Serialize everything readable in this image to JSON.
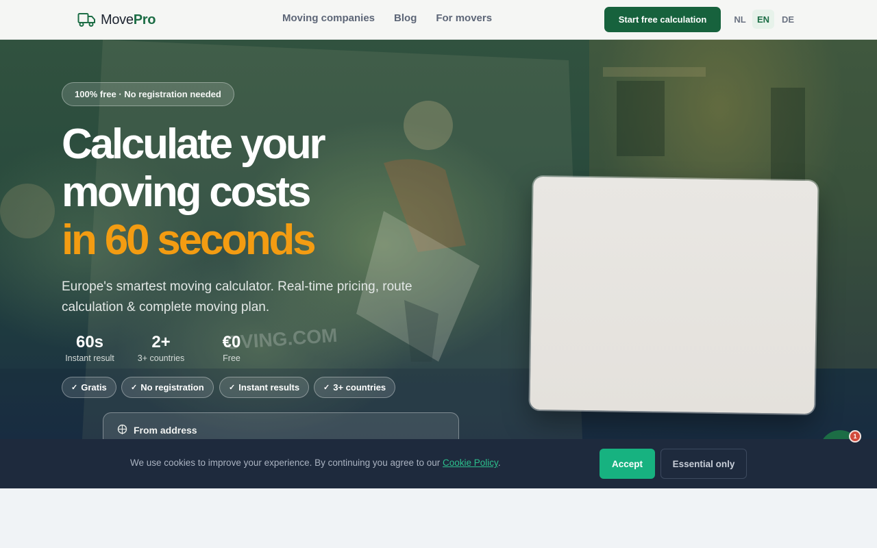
{
  "header": {
    "logo": {
      "prefix": "Move",
      "suffix": "Pro",
      "icon": "truck-icon"
    },
    "nav": [
      "Moving companies",
      "Blog",
      "For movers"
    ],
    "cta": "Start free calculation",
    "languages": [
      {
        "code": "NL",
        "active": false
      },
      {
        "code": "EN",
        "active": true
      },
      {
        "code": "DE",
        "active": false
      }
    ]
  },
  "hero": {
    "badge": "100% free · No registration needed",
    "title_line1": "Calculate your",
    "title_line2": "moving costs",
    "title_line3": "in 60 seconds",
    "subtitle": "Europe's smartest moving calculator. Real-time pricing, route calculation & complete moving plan.",
    "stats": [
      {
        "value": "60s",
        "label": "Instant result"
      },
      {
        "value": "2+",
        "label": "3+ countries"
      },
      {
        "value": "€0",
        "label": "Free"
      }
    ],
    "chips": [
      "Gratis",
      "No registration",
      "Instant results",
      "3+ countries"
    ],
    "from_address_label": "From address"
  },
  "cookie": {
    "text": "We use cookies to improve your experience. By continuing you agree to our",
    "link": "Cookie Policy",
    "end": ".",
    "accept": "Accept",
    "essential": "Essential only"
  },
  "chat": {
    "badge_count": "1"
  },
  "colors": {
    "brand_green": "#17623d",
    "accent_orange": "#f39c12",
    "accept_green": "#17b280",
    "cookie_bg": "#1e2a3d"
  }
}
